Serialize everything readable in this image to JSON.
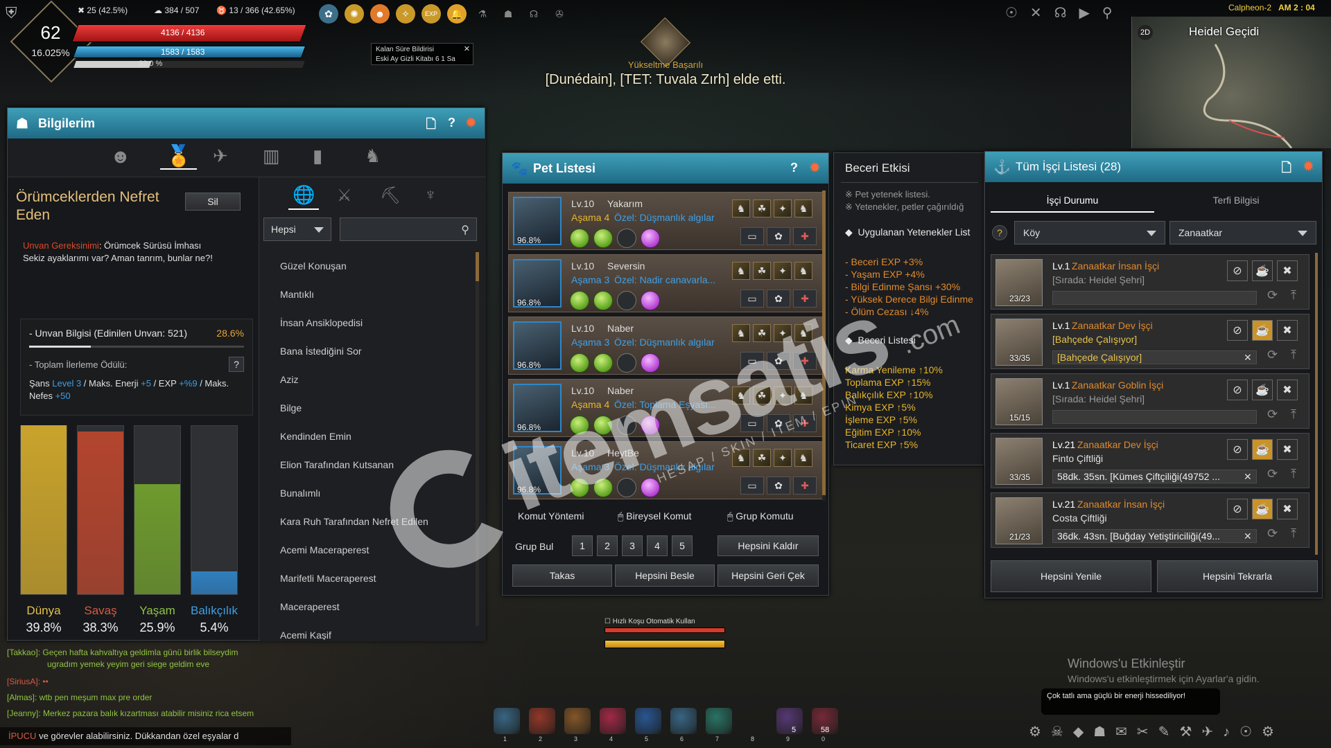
{
  "hud": {
    "level": "62",
    "level_pct": "16.025%",
    "stat1": "25 (42.5%)",
    "stat2": "384 / 507",
    "stat3": "13 / 366 (42.65%)",
    "hp": "4136 / 4136",
    "mp": "1583 / 1583",
    "bar3": "33.0 %",
    "hp_fill": 1.0,
    "mp_fill": 1.0,
    "bar3_fill": 0.33
  },
  "notice": {
    "line1": "Kalan Süre Bildirisi",
    "line2": "Eski Ay Gizli Kitabı  6  1 Sa"
  },
  "banner": {
    "subtitle": "Yükseltme Başarılı",
    "message": "[Dunédain], [TET: Tuvala Zırh] elde etti."
  },
  "topright": {
    "server": "Calpheon-2",
    "time": "AM 2 : 04",
    "map_label": "Heidel Geçidi",
    "map_mode": "2D"
  },
  "bilgilerim": {
    "title": "Bilgilerim",
    "unvan_title": "Örümceklerden Nefret Eden",
    "sil": "Sil",
    "req_label": "Unvan Gereksinimi",
    "req_text": ": Örümcek Sürüsü İmhası",
    "desc": "Sekiz ayaklarımı var? Aman tanrım, bunlar ne?!",
    "info_label": "- Unvan Bilgisi (Edinilen Unvan: 521)",
    "info_pct": "28.6%",
    "info_fill": 0.286,
    "reward_label": "- Toplam İlerleme Ödülü:",
    "reward_q": "?",
    "reward_p1": "Şans ",
    "reward_p1v": "Level 3",
    "reward_p2": " / Maks. Enerji ",
    "reward_p2v": "+5",
    "reward_p3": " / EXP ",
    "reward_p3v": "+%9",
    "reward_p4": " / Maks. Nefes ",
    "reward_p4v": "+50",
    "filter": "Hepsi",
    "search_placeholder": "",
    "titles": [
      "Güzel Konuşan",
      "Mantıklı",
      "İnsan Ansiklopedisi",
      "Bana İstediğini Sor",
      "Aziz",
      "Bilge",
      "Kendinden Emin",
      "Elion Tarafından Kutsanan",
      "Bunalımlı",
      "Kara Ruh Tarafından Nefret Edilen",
      "Acemi Maceraperest",
      "Marifetli Maceraperest",
      "Maceraperest",
      "Acemi Kaşif"
    ],
    "cats": [
      {
        "name": "Dünya",
        "pct": "39.8%",
        "value": 0.398,
        "color": "#c9a32c",
        "label_color": "#e6c24a"
      },
      {
        "name": "Savaş",
        "pct": "38.3%",
        "value": 0.383,
        "color": "#b3452e",
        "label_color": "#d65a44"
      },
      {
        "name": "Yaşam",
        "pct": "25.9%",
        "value": 0.259,
        "color": "#6e9a2e",
        "label_color": "#8fc443"
      },
      {
        "name": "Balıkçılık",
        "pct": "5.4%",
        "value": 0.054,
        "color": "#2f7fbf",
        "label_color": "#3fa0e6"
      }
    ]
  },
  "pet": {
    "title": "Pet Listesi",
    "pets": [
      {
        "lv": "Lv.10",
        "name": "Yakarım",
        "asama": "Aşama 4",
        "ozel": "Özel: Düşmanlık algılar",
        "pct": "96.8%",
        "asama_color": "#e6b62c"
      },
      {
        "lv": "Lv.10",
        "name": "Seversin",
        "asama": "Aşama 3",
        "ozel": "Özel: Nadir canavarla...",
        "pct": "96.8%",
        "asama_color": "#3fa0e6"
      },
      {
        "lv": "Lv.10",
        "name": "Naber",
        "asama": "Aşama 3",
        "ozel": "Özel: Düşmanlık algılar",
        "pct": "96.8%",
        "asama_color": "#3fa0e6"
      },
      {
        "lv": "Lv.10",
        "name": "Naber",
        "asama": "Aşama 4",
        "ozel": "Özel: Toplama Eşyası...",
        "pct": "96.8%",
        "asama_color": "#e6b62c"
      },
      {
        "lv": "Lv.10",
        "name": "HeytBe",
        "asama": "Aşama 3",
        "ozel": "Özel: Düşmanlık algılar",
        "pct": "96.8%",
        "asama_color": "#3fa0e6"
      }
    ],
    "komut_label": "Komut Yöntemi",
    "bireysel": "Bireysel Komut",
    "grup_komut": "Grup Komutu",
    "grup_bul": "Grup Bul",
    "group_nums": [
      "1",
      "2",
      "3",
      "4",
      "5"
    ],
    "hepsini_kaldir": "Hepsini Kaldır",
    "takas": "Takas",
    "hepsini_besle": "Hepsini Besle",
    "hepsini_geri": "Hepsini Geri Çek"
  },
  "beceri": {
    "title": "Beceri Etkisi",
    "note1": "※ Pet yetenek listesi.",
    "note2": "※ Yetenekler, petler çağırıldığ",
    "applied": "Uygulanan Yetenekler List",
    "applied_items": [
      "- Beceri EXP +3%",
      "- Yaşam EXP +4%",
      "- Bilgi Edinme Şansı +30%",
      "- Yüksek Derece Bilgi Edinme",
      "- Ölüm Cezası ↓4%"
    ],
    "list_label": "Beceri Listesi",
    "list_items": [
      "Karma Yenileme ↑10%",
      "Toplama EXP ↑15%",
      "Balıkçılık EXP ↑10%",
      "Kimya EXP ↑5%",
      "İşleme EXP ↑5%",
      "Eğitim EXP ↑10%",
      "Ticaret EXP ↑5%"
    ]
  },
  "isci": {
    "title": "Tüm İşçi Listesi (28)",
    "tab1": "İşçi Durumu",
    "tab2": "Terfi Bilgisi",
    "sel1": "Köy",
    "sel2": "Zanaatkar",
    "workers": [
      {
        "lv": "Lv.1",
        "type": "Zanaatkar İnsan İşçi",
        "sub": "[Sırada: Heidel Şehri]",
        "sub_color": "#9a9a9a",
        "count": "23/23",
        "task": ""
      },
      {
        "lv": "Lv.1",
        "type": "Zanaatkar Dev İşçi",
        "sub": "[Bahçede Çalışıyor]",
        "sub_color": "#e6c24a",
        "count": "33/35",
        "task": "[Bahçede Çalışıyor]"
      },
      {
        "lv": "Lv.1",
        "type": "Zanaatkar Goblin İşçi",
        "sub": "[Sırada: Heidel Şehri]",
        "sub_color": "#9a9a9a",
        "count": "15/15",
        "task": ""
      },
      {
        "lv": "Lv.21",
        "type": "Zanaatkar Dev İşçi",
        "sub": "Finto Çiftliği",
        "sub_color": "#e0e0e0",
        "count": "33/35",
        "task": "58dk. 35sn. [Kümes Çiftçiliği(49752 ..."
      },
      {
        "lv": "Lv.21",
        "type": "Zanaatkar İnsan İşçi",
        "sub": "Costa Çiftliği",
        "sub_color": "#e0e0e0",
        "count": "21/23",
        "task": "36dk. 43sn. [Buğday Yetiştiriciliği(49..."
      }
    ],
    "yenile": "Hepsini Yenile",
    "tekrarla": "Hepsini Tekrarla"
  },
  "stamina": {
    "label": "Hızlı Koşu Otomatik Kullan"
  },
  "chat": [
    {
      "who": "[Takkao]",
      "text": ": Geçen hafta kahvaltıya geldimla günü birlik bilseydim",
      "color": "#8fc443"
    },
    {
      "who": "",
      "text": "ugradım yemek yeyim geri siege geldim eve",
      "color": "#8fc443"
    },
    {
      "who": "[SiriusA]",
      "text": ": ••",
      "color": "#d65a44"
    },
    {
      "who": "[Almas]",
      "text": ": wtb pen meşum max pre order",
      "color": "#8fc443"
    },
    {
      "who": "[Jeanny]",
      "text": ": Merkez pazara balık kızartması atabilir misiniz rica etsem",
      "color": "#8fc443"
    }
  ],
  "tip": {
    "label": "İPUCU",
    "text": "ve görevler alabilirsiniz. Dükkandan özel eşyalar d"
  },
  "windows": {
    "title": "Windows'u Etkinleştir",
    "sub": "Windows'u etkinleştirmek için Ayarlar'a gidin."
  },
  "toast": "Çok tatlı ama güçlü bir enerji hissediliyor!",
  "hotbar": {
    "nums": [
      "1",
      "2",
      "3",
      "4",
      "5",
      "6",
      "7",
      "8",
      "9",
      "0"
    ],
    "count1": "5",
    "count2": "58"
  },
  "watermark": {
    "brand": "itemsatis",
    "sub": "HESAP / SKIN / ITEM / EPIN",
    "dotcom": ".com"
  },
  "colors": {
    "teal": "#2f87a8",
    "gold": "#e6b62c",
    "red_text": "#d94a2a",
    "blue_text": "#3fa0e6",
    "orange_text": "#e08a2c"
  }
}
